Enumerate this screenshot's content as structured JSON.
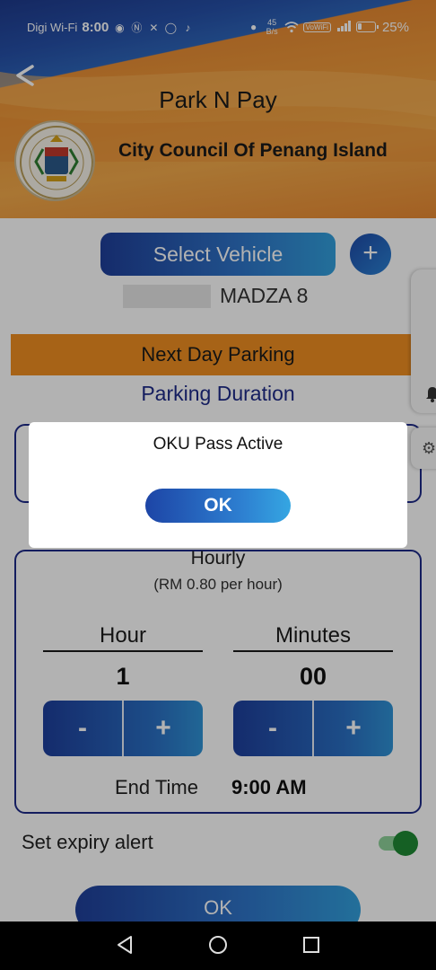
{
  "status_bar": {
    "carrier": "Digi Wi-Fi",
    "time": "8:00",
    "net_speed_value": "45",
    "net_speed_unit": "B/s",
    "wifi_badge": "VoWiFi",
    "battery_percent": "25%",
    "battery_level": 0.25
  },
  "header": {
    "back_icon": "back-arrow-icon",
    "title": "Park N Pay",
    "organization": "City Council Of Penang Island"
  },
  "vehicle": {
    "select_label": "Select Vehicle",
    "add_label": "+",
    "name": "MADZA 8"
  },
  "next_day_label": "Next Day Parking",
  "duration_label": "Parking Duration",
  "hourly": {
    "title": "Hourly",
    "rate": "(RM 0.80 per hour)",
    "hour_label": "Hour",
    "hour_value": "1",
    "minutes_label": "Minutes",
    "minutes_value": "00",
    "minus": "-",
    "plus": "+",
    "end_label": "End Time",
    "end_value": "9:00 AM"
  },
  "alert": {
    "label": "Set expiry alert",
    "enabled": true
  },
  "main_ok": "OK",
  "dialog": {
    "message": "OKU Pass Active",
    "ok": "OK"
  },
  "colors": {
    "accent_blue": "#2f75c9",
    "header_orange": "#ee9a3b",
    "next_day_orange": "#f08f22",
    "navy": "#1e2a88",
    "toggle_green": "#1f8a34"
  }
}
